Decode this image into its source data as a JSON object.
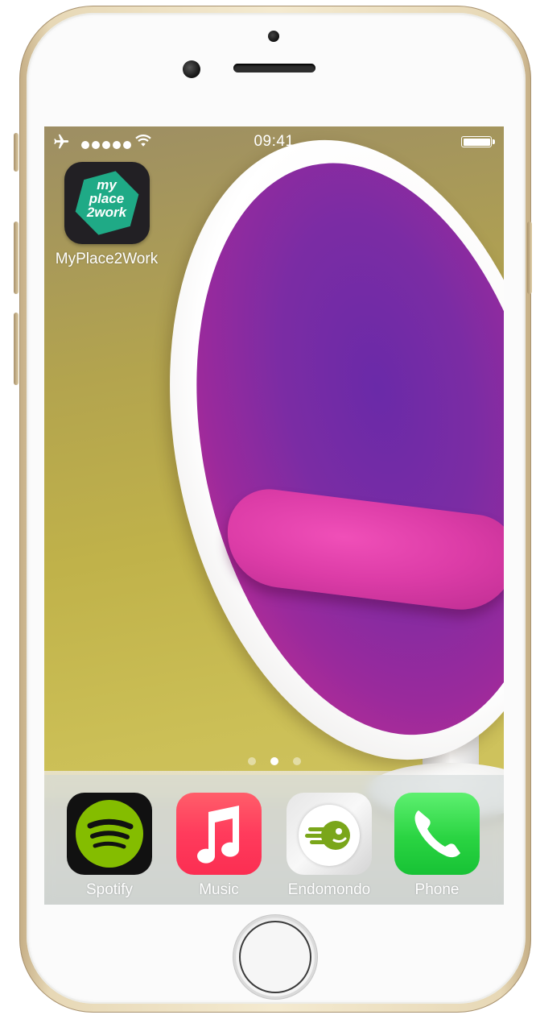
{
  "status_bar": {
    "time": "09:41",
    "airplane_mode": true,
    "signal_dots": 5,
    "wifi": true,
    "battery_level": 1.0
  },
  "home_apps": [
    {
      "label": "MyPlace2Work",
      "icon": "myplace2work-icon",
      "icon_text": [
        "my",
        "place",
        "2work"
      ]
    }
  ],
  "page_indicator": {
    "pages": 3,
    "current": 2
  },
  "dock_apps": [
    {
      "label": "Spotify",
      "icon": "spotify-icon"
    },
    {
      "label": "Music",
      "icon": "music-note-icon"
    },
    {
      "label": "Endomondo",
      "icon": "endomondo-icon"
    },
    {
      "label": "Phone",
      "icon": "phone-handset-icon"
    }
  ],
  "colors": {
    "frame_gold": "#e7d8b6",
    "myplace2work_green": "#1faa86",
    "spotify_green": "#84bd00",
    "music_red": "#fb2e52",
    "endomondo_green": "#7aa61a",
    "phone_green": "#2ad442"
  }
}
